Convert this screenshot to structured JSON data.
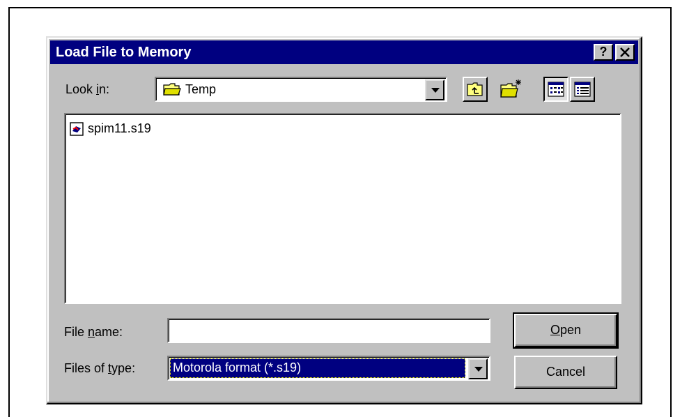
{
  "window": {
    "title": "Load File to Memory",
    "help_label": "?",
    "close_label": "✕"
  },
  "look_in": {
    "label_pre": "Look ",
    "label_hot": "i",
    "label_post": "n:",
    "value": "Temp"
  },
  "files": [
    {
      "name": "spim11.s19"
    }
  ],
  "file_name": {
    "label_pre": "File ",
    "label_hot": "n",
    "label_post": "ame:",
    "value": ""
  },
  "files_of_type": {
    "label_pre": "Files of ",
    "label_hot": "t",
    "label_post": "ype:",
    "value": "Motorola format (*.s19)"
  },
  "buttons": {
    "open_hot": "O",
    "open_rest": "pen",
    "cancel": "Cancel"
  },
  "colors": {
    "title_bar": "#000080",
    "face": "#c0c0c0",
    "selection": "#000080"
  },
  "icons": [
    "folder-icon",
    "up-folder-icon",
    "new-folder-icon",
    "list-view-icon",
    "details-view-icon",
    "s19-file-icon",
    "chevron-down-icon"
  ]
}
